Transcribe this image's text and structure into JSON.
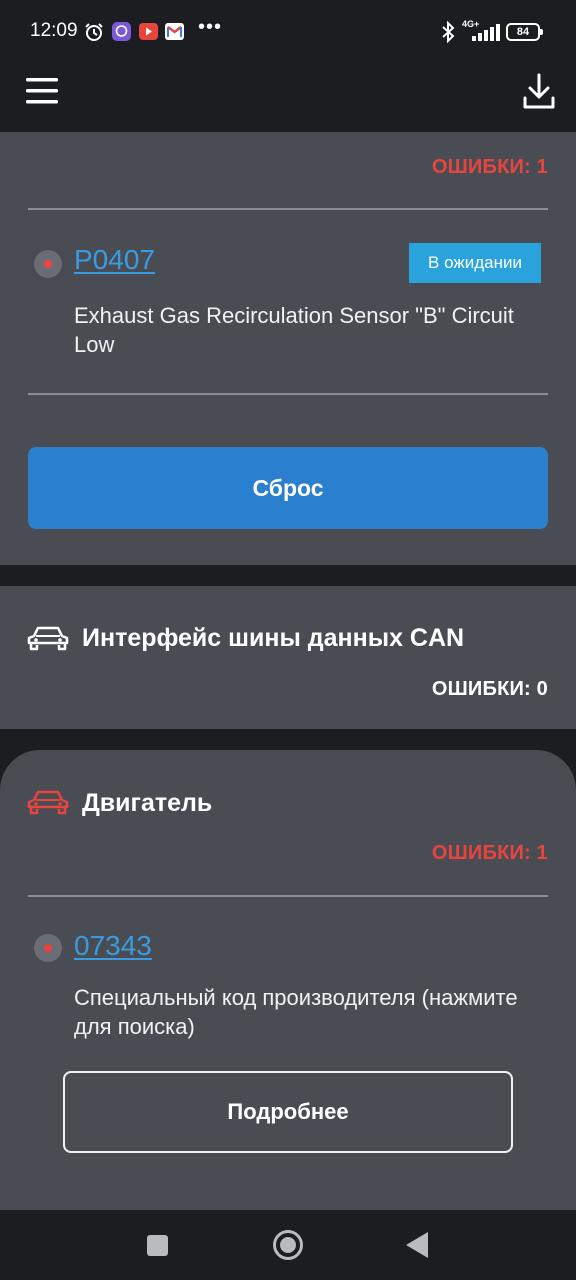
{
  "status_bar": {
    "time": "12:09",
    "network": "4G+",
    "battery": "84",
    "more": "•••"
  },
  "header": {
    "menu_icon": "hamburger-menu-icon",
    "download_icon": "download-icon"
  },
  "colors": {
    "error_red": "#e8453f",
    "link_blue": "#3a9be0",
    "badge_blue": "#2aa3dc",
    "button_blue": "#2a7fce",
    "card_bg": "#4a4c54",
    "page_bg": "#1c1d21"
  },
  "sections": [
    {
      "errors_label": "ОШИБКИ: 1",
      "fault": {
        "code": "P0407",
        "status": "В ожидании",
        "description": "Exhaust Gas Recirculation Sensor \"B\" Circuit Low"
      },
      "action_label": "Сброс"
    },
    {
      "title": "Интерфейс шины данных CAN",
      "icon": "car-icon",
      "errors_label": "ОШИБКИ: 0"
    },
    {
      "title": "Двигатель",
      "icon": "car-icon",
      "errors_label": "ОШИБКИ: 1",
      "fault": {
        "code": "07343",
        "description": "Специальный код производителя (нажмите для поиска)"
      },
      "action_label": "Подробнее"
    }
  ],
  "nav_bar": {
    "recents": "recents-icon",
    "home": "home-icon",
    "back": "back-icon"
  }
}
